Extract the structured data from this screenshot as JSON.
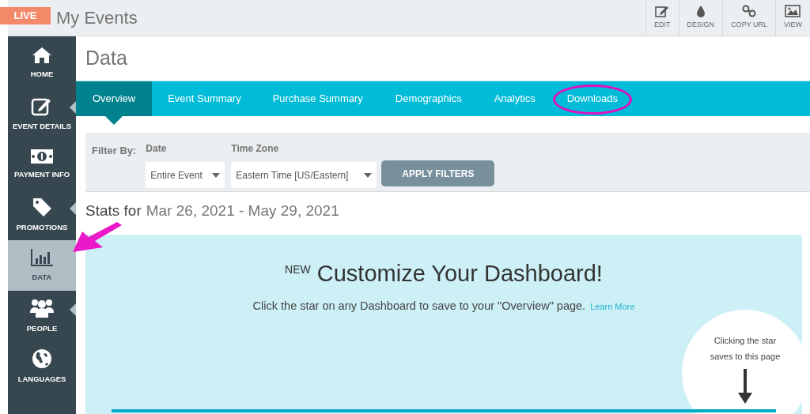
{
  "header": {
    "badge": "LIVE",
    "title": "My Events",
    "tools": [
      {
        "kind": "edit",
        "label": "EDIT"
      },
      {
        "kind": "design",
        "label": "DESIGN"
      },
      {
        "kind": "link",
        "label": "COPY URL"
      },
      {
        "kind": "view",
        "label": "VIEW"
      }
    ]
  },
  "sidebar": {
    "items": [
      {
        "kind": "home",
        "label": "HOME",
        "selected": false,
        "submenu": false
      },
      {
        "kind": "edit",
        "label": "EVENT DETAILS",
        "selected": false,
        "submenu": true
      },
      {
        "kind": "money",
        "label": "PAYMENT INFO",
        "selected": false,
        "submenu": false
      },
      {
        "kind": "tag",
        "label": "PROMOTIONS",
        "selected": false,
        "submenu": true
      },
      {
        "kind": "chart",
        "label": "DATA",
        "selected": true,
        "submenu": false
      },
      {
        "kind": "people",
        "label": "PEOPLE",
        "selected": false,
        "submenu": true
      },
      {
        "kind": "globe",
        "label": "LANGUAGES",
        "selected": false,
        "submenu": false
      }
    ]
  },
  "page_title": "Data",
  "tabs": [
    {
      "label": "Overview",
      "selected": true,
      "circled": false
    },
    {
      "label": "Event Summary",
      "selected": false,
      "circled": false
    },
    {
      "label": "Purchase Summary",
      "selected": false,
      "circled": false
    },
    {
      "label": "Demographics",
      "selected": false,
      "circled": false
    },
    {
      "label": "Analytics",
      "selected": false,
      "circled": false
    },
    {
      "label": "Downloads",
      "selected": false,
      "circled": true
    }
  ],
  "filters": {
    "label": "Filter By:",
    "fields": [
      {
        "label": "Date",
        "value": "Entire Event"
      },
      {
        "label": "Time Zone",
        "value": "Eastern Time [US/Eastern]"
      }
    ],
    "button": "APPLY FILTERS"
  },
  "stats": {
    "prefix": "Stats for",
    "range": "Mar 26, 2021 - May 29, 2021"
  },
  "promo": {
    "badge": "NEW",
    "title": "Customize Your Dashboard!",
    "text": "Click the star on any Dashboard to save to your \"Overview\" page.",
    "link": "Learn More",
    "bubble": "Clicking the star saves to this page"
  }
}
